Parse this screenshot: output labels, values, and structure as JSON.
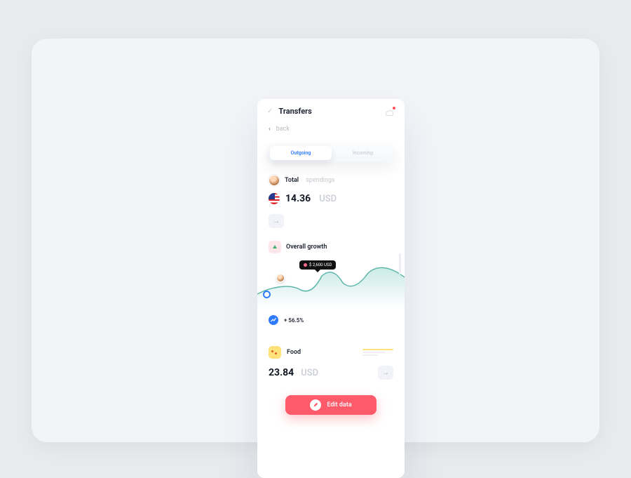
{
  "header": {
    "title": "Transfers",
    "back_label": "back"
  },
  "tabs": {
    "active": "Outgoing",
    "inactive": "Incoming"
  },
  "total": {
    "label": "Total",
    "sublabel": "spendings",
    "amount": "14.36",
    "currency": "USD"
  },
  "growth": {
    "title": "Overall growth",
    "tooltip": "$ 2,600 USD",
    "trend": "+ 56.5%"
  },
  "food": {
    "label": "Food",
    "amount": "23.84",
    "currency": "USD"
  },
  "edit_button": "Edit data",
  "chart_data": {
    "type": "line",
    "x": [
      0,
      1,
      2,
      3,
      4,
      5,
      6,
      7
    ],
    "values": [
      32,
      40,
      44,
      36,
      62,
      48,
      70,
      60
    ],
    "ylim": [
      0,
      80
    ],
    "tooltip_point_index": 4,
    "tooltip_value": "$ 2,600 USD"
  }
}
